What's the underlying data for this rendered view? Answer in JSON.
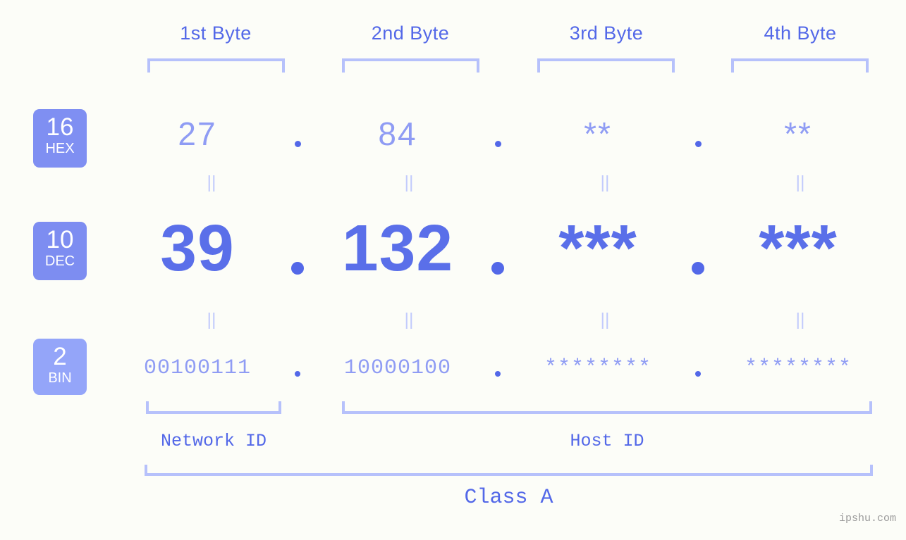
{
  "meta": {
    "background_color": "#fcfdf8",
    "accent_color": "#5368e8",
    "light_accent_color": "#b6c1fb",
    "muted_value_color": "#8f9cf4"
  },
  "headers": [
    {
      "label": "1st Byte"
    },
    {
      "label": "2nd Byte"
    },
    {
      "label": "3rd Byte"
    },
    {
      "label": "4th Byte"
    }
  ],
  "bases": {
    "hex": {
      "number": "16",
      "name": "HEX",
      "color": "#7f8ff2"
    },
    "dec": {
      "number": "10",
      "name": "DEC",
      "color": "#7d8df1"
    },
    "bin": {
      "number": "2",
      "name": "BIN",
      "color": "#94a5f9"
    }
  },
  "rows": {
    "hex": {
      "octets": [
        "27",
        "84",
        "**",
        "**"
      ]
    },
    "dec": {
      "octets": [
        "39",
        "132",
        "***",
        "***"
      ]
    },
    "bin": {
      "octets": [
        "00100111",
        "10000100",
        "********",
        "********"
      ]
    }
  },
  "separator": {
    "glyph": "."
  },
  "equals_marks": {
    "glyph": "||"
  },
  "id_sections": {
    "network": {
      "label": "Network ID"
    },
    "host": {
      "label": "Host ID"
    }
  },
  "class_section": {
    "label": "Class A"
  },
  "watermark": {
    "text": "ipshu.com"
  }
}
